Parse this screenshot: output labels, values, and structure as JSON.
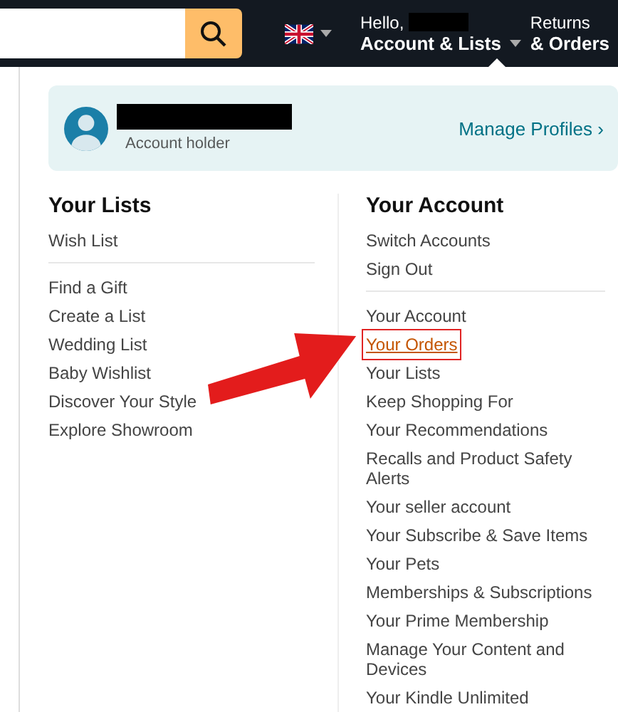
{
  "header": {
    "language_menu": {
      "expanded": false
    },
    "greeting": "Hello,",
    "account_menu": {
      "label": "Account & Lists",
      "expanded": true
    },
    "returns": {
      "line1": "Returns",
      "line2": "& Orders"
    }
  },
  "profile": {
    "role": "Account holder",
    "manage_link": "Manage Profiles",
    "chevron": "›"
  },
  "your_lists": {
    "heading": "Your Lists",
    "groups": [
      {
        "items": [
          {
            "label": "Wish List",
            "hovered": false,
            "highlighted": false
          }
        ]
      },
      {
        "items": [
          {
            "label": "Find a Gift",
            "hovered": false,
            "highlighted": false
          },
          {
            "label": "Create a List",
            "hovered": false,
            "highlighted": false
          },
          {
            "label": "Wedding List",
            "hovered": false,
            "highlighted": false
          },
          {
            "label": "Baby Wishlist",
            "hovered": false,
            "highlighted": false
          },
          {
            "label": "Discover Your Style",
            "hovered": false,
            "highlighted": false
          },
          {
            "label": "Explore Showroom",
            "hovered": false,
            "highlighted": false
          }
        ]
      }
    ]
  },
  "your_account": {
    "heading": "Your Account",
    "groups": [
      {
        "items": [
          {
            "label": "Switch Accounts",
            "hovered": false,
            "highlighted": false
          },
          {
            "label": "Sign Out",
            "hovered": false,
            "highlighted": false
          }
        ]
      },
      {
        "items": [
          {
            "label": "Your Account",
            "hovered": false,
            "highlighted": false
          },
          {
            "label": "Your Orders",
            "hovered": true,
            "highlighted": true
          },
          {
            "label": "Your Lists",
            "hovered": false,
            "highlighted": false
          },
          {
            "label": "Keep Shopping For",
            "hovered": false,
            "highlighted": false
          },
          {
            "label": "Your Recommendations",
            "hovered": false,
            "highlighted": false
          },
          {
            "label": "Recalls and Product Safety Alerts",
            "hovered": false,
            "highlighted": false
          },
          {
            "label": "Your seller account",
            "hovered": false,
            "highlighted": false
          },
          {
            "label": "Your Subscribe & Save Items",
            "hovered": false,
            "highlighted": false
          },
          {
            "label": "Your Pets",
            "hovered": false,
            "highlighted": false
          },
          {
            "label": "Memberships & Subscriptions",
            "hovered": false,
            "highlighted": false
          },
          {
            "label": "Your Prime Membership",
            "hovered": false,
            "highlighted": false
          },
          {
            "label": "Manage Your Content and Devices",
            "hovered": false,
            "highlighted": false
          },
          {
            "label": "Your Kindle Unlimited",
            "hovered": false,
            "highlighted": false
          }
        ]
      }
    ]
  }
}
